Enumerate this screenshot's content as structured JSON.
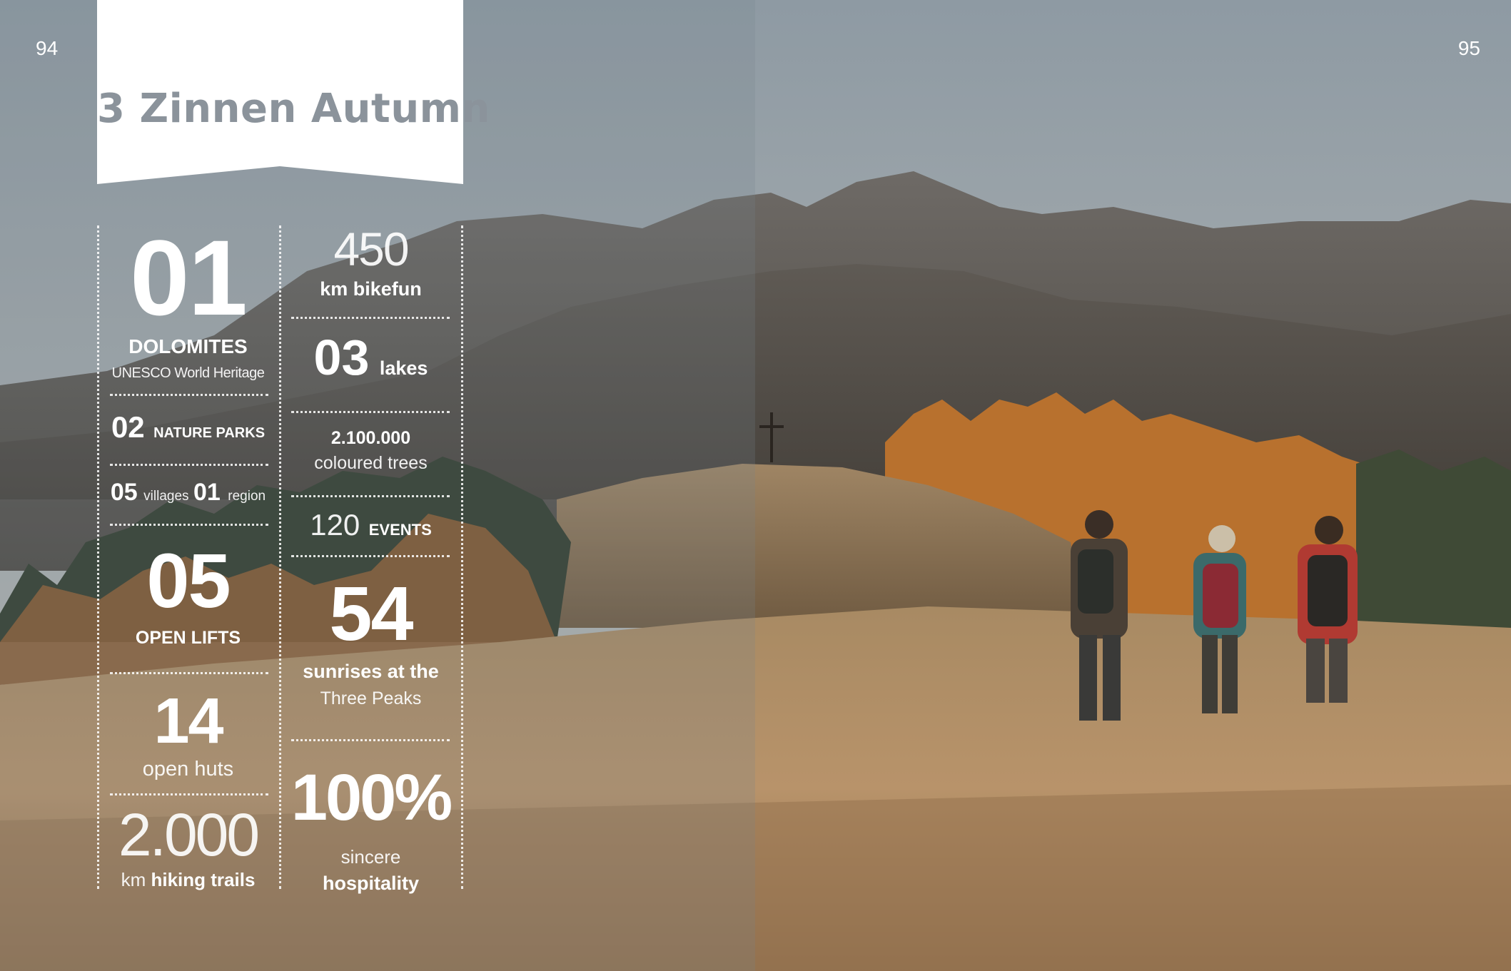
{
  "page": {
    "left_number": "94",
    "right_number": "95",
    "title": "3 Zinnen Autumn"
  },
  "stats": {
    "dolomites": {
      "number": "01",
      "label": "DOLOMITES",
      "sub": "UNESCO World Heritage"
    },
    "nature_parks": {
      "number": "02",
      "label": "NATURE PARKS"
    },
    "villages": {
      "number": "05",
      "label": "villages",
      "number2": "01",
      "label2": "region"
    },
    "lifts": {
      "number": "05",
      "label": "OPEN LIFTS"
    },
    "huts": {
      "number": "14",
      "label": "open huts"
    },
    "hiking": {
      "number": "2.000",
      "unit": "km",
      "label": "hiking trails"
    },
    "bikefun": {
      "number": "450",
      "label": "km bikefun"
    },
    "lakes": {
      "number": "03",
      "label": "lakes"
    },
    "trees": {
      "number": "2.100.000",
      "label": "coloured trees"
    },
    "events": {
      "number": "120",
      "label": "EVENTS"
    },
    "sunrises": {
      "number": "54",
      "label": "sunrises at the",
      "sub": "Three Peaks"
    },
    "hospitality": {
      "number": "100%",
      "label": "sincere",
      "sub": "hospitality"
    }
  },
  "colors": {
    "title": "#8b939b",
    "banner": "#ffffff",
    "text": "#ffffff"
  },
  "photo": {
    "subject": "hikers-in-autumn-meadow"
  }
}
